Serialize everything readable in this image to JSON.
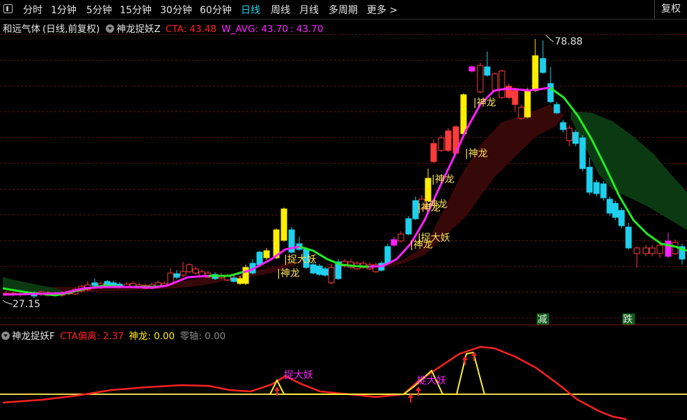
{
  "toolbar": {
    "periods": [
      "分时",
      "1分钟",
      "5分钟",
      "15分钟",
      "30分钟",
      "60分钟",
      "日线",
      "周线",
      "月线",
      "多周期",
      "更多 >"
    ],
    "active": "日线",
    "fq_label": "复权"
  },
  "main_header": {
    "stock": "和远气体",
    "period_info": "(日线,前复权)",
    "indicator": "神龙捉妖Z",
    "cta": "CTA: 43.48",
    "w_avg": "W_AVG: 43.70",
    "third": ": 43.70"
  },
  "sub_header": {
    "indicator": "神龙捉妖F",
    "cta": "CTA偏离: 2.37",
    "shenlong": "神龙: 0.00",
    "zero": "零轴: 0.00"
  },
  "price_labels": {
    "high": "78.88",
    "low": "27.15"
  },
  "signals": {
    "shenlong": "神龙",
    "zhuodayao": "捉大妖",
    "jian": "减",
    "die": "跌"
  },
  "colors": {
    "up": "#ff3b3b",
    "down": "#1fd0ee",
    "yellow": "#ffee00",
    "magenta": "#ff22ff",
    "green": "#22ee22",
    "cloud_dark": "#3a0808",
    "cloud_green": "#0b3a12",
    "cta_red": "#ff2222",
    "signal_yellow": "#ffe35a"
  },
  "chart_data": {
    "type": "candlestick",
    "ylim": [
      27.15,
      78.88
    ],
    "last_values": {
      "CTA": 43.48,
      "W_AVG": 43.7
    },
    "sub_values": {
      "CTA偏离": 2.37,
      "神龙": 0.0,
      "零轴": 0.0
    }
  }
}
